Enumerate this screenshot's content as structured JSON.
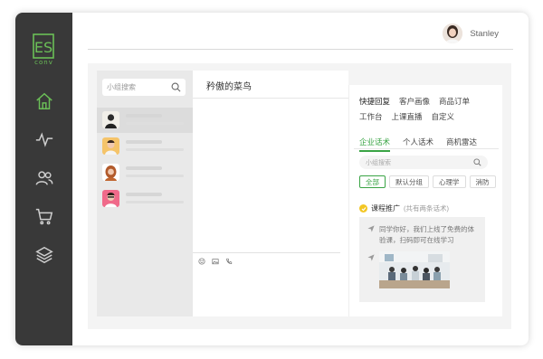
{
  "brand": {
    "logo_text": "conv",
    "accent": "#3aa445"
  },
  "sidebar": {
    "items": [
      {
        "icon": "home-icon",
        "active": true
      },
      {
        "icon": "pulse-icon"
      },
      {
        "icon": "users-icon"
      },
      {
        "icon": "cart-icon"
      },
      {
        "icon": "layers-icon"
      }
    ]
  },
  "header": {
    "username": "Stanley"
  },
  "contacts": {
    "search_placeholder": "小组搜索",
    "items": [
      {},
      {},
      {},
      {}
    ]
  },
  "chat": {
    "title": "矜傲的菜鸟"
  },
  "assistant": {
    "quick_tabs": [
      "快捷回复",
      "客户画像",
      "商品订单",
      "工作台",
      "上课直播",
      "自定义"
    ],
    "tabs": [
      "企业话术",
      "个人话术",
      "商机雷达"
    ],
    "search_placeholder": "小组搜索",
    "filters": [
      "全部",
      "默认分组",
      "心理学",
      "消防"
    ],
    "category": {
      "name": "课程推广",
      "note": "(共有两条话术)"
    },
    "card_text": "同学你好，我们上线了免费的体验课，扫码即可在线学习"
  }
}
